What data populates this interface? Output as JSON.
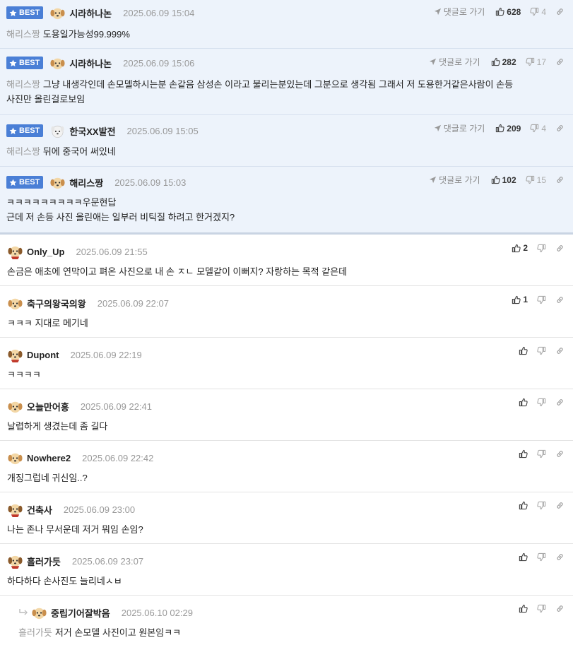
{
  "best_label": "BEST",
  "goto_label": "댓글로 가기",
  "best": [
    {
      "nick": "시라하나논",
      "date": "2025.06.09 15:04",
      "mention": "해리스짱",
      "lines": [
        "도용일가능성99.999%"
      ],
      "likes": "628",
      "dislikes": "4",
      "avatar": "pup"
    },
    {
      "nick": "시라하나논",
      "date": "2025.06.09 15:06",
      "mention": "해리스짱",
      "lines": [
        "그냥 내생각인데 손모델하시는분 손같음 삼성손 이라고 불리는분있는데 그분으로 생각됨 그래서 저 도용한거같은사람이 손등",
        "사진만 올린걸로보임"
      ],
      "likes": "282",
      "dislikes": "17",
      "avatar": "pup"
    },
    {
      "nick": "한국XX발전",
      "date": "2025.06.09 15:05",
      "mention": "해리스짱",
      "lines": [
        "뒤에 중국어 써있네"
      ],
      "likes": "209",
      "dislikes": "4",
      "avatar": "white"
    },
    {
      "nick": "해리스짱",
      "date": "2025.06.09 15:03",
      "mention": "",
      "lines": [
        "ㅋㅋㅋㅋㅋㅋㅋㅋㅋ우문현답",
        "근데 저 손등 사진 올린애는 일부러 비틱질 하려고 한거겠지?"
      ],
      "likes": "102",
      "dislikes": "15",
      "avatar": "pup"
    }
  ],
  "comments": [
    {
      "nick": "Only_Up",
      "date": "2025.06.09 21:55",
      "mention": "",
      "text": "손금은 애초에 연막이고 펴온 사진으로 내 손 ㅈㄴ 모델같이 이뻐지? 자랑하는 목적 같은데",
      "likes": "2",
      "avatar": "red"
    },
    {
      "nick": "축구의왕국의왕",
      "date": "2025.06.09 22:07",
      "mention": "",
      "text": "ㅋㅋㅋ 지대로 메기네",
      "likes": "1",
      "avatar": "pup"
    },
    {
      "nick": "Dupont",
      "date": "2025.06.09 22:19",
      "mention": "",
      "text": "ㅋㅋㅋㅋ",
      "likes": "",
      "avatar": "red"
    },
    {
      "nick": "오늘만어흥",
      "date": "2025.06.09 22:41",
      "mention": "",
      "text": "날렵하게 생겼는데 좀 길다",
      "likes": "",
      "avatar": "pup"
    },
    {
      "nick": "Nowhere2",
      "date": "2025.06.09 22:42",
      "mention": "",
      "text": "개징그럽네 귀신임..?",
      "likes": "",
      "avatar": "pup"
    },
    {
      "nick": "건축사",
      "date": "2025.06.09 23:00",
      "mention": "",
      "text": "나는 존나 무서운데 저거 뭐임 손임?",
      "likes": "",
      "avatar": "red"
    },
    {
      "nick": "흘러가듯",
      "date": "2025.06.09 23:07",
      "mention": "",
      "text": "하다하다 손사진도 늘리네ㅅㅂ",
      "likes": "",
      "avatar": "red"
    },
    {
      "nick": "중립기어잘박음",
      "date": "2025.06.10 02:29",
      "mention": "흘러가듯",
      "text": "저거 손모델 사진이고 원본임ㅋㅋ",
      "likes": "",
      "avatar": "pup",
      "reply": true
    }
  ],
  "icons": {
    "like": "thumbs-up-icon",
    "dislike": "thumbs-down-icon",
    "link": "link-icon",
    "goto": "arrow-icon",
    "star": "star-icon",
    "reply": "reply-arrow-icon"
  },
  "colors": {
    "best_badge": "#4a7fd6",
    "best_bg": "#edf3fb",
    "date": "#999999",
    "mention": "#9a9a9a"
  }
}
